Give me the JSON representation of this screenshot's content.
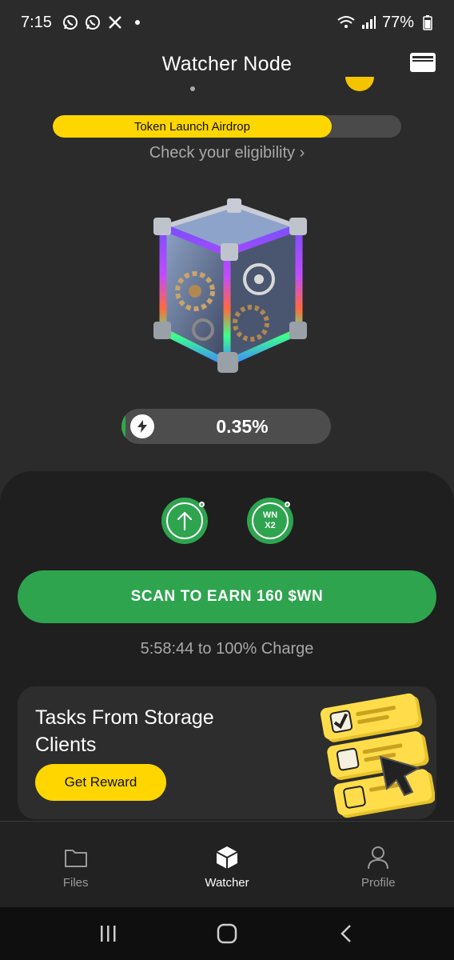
{
  "status_bar": {
    "time": "7:15",
    "battery": "77%",
    "notification_icons": [
      "whatsapp-icon",
      "whatsapp-icon",
      "x-icon"
    ]
  },
  "header": {
    "title": "Watcher Node",
    "wallet_icon": "wallet-icon"
  },
  "airdrop": {
    "label": "Token Launch Airdrop",
    "progress": 0.8,
    "eligibility_link": "Check your eligibility ›"
  },
  "charge": {
    "icon": "bolt-icon",
    "value": "0.35%"
  },
  "actions": {
    "upload_icon": "arrow-up-icon",
    "multiplier_line1": "WN",
    "multiplier_line2": "X2",
    "scan_label": "SCAN TO EARN 160 $WN",
    "charge_time": "5:58:44 to 100% Charge"
  },
  "tasks": {
    "title": "Tasks From Storage Clients",
    "button": "Get Reward"
  },
  "tabs": [
    {
      "label": "Files",
      "icon": "folder-icon",
      "active": false
    },
    {
      "label": "Watcher",
      "icon": "cube-icon",
      "active": true
    },
    {
      "label": "Profile",
      "icon": "person-icon",
      "active": false
    }
  ],
  "colors": {
    "accent_green": "#2ea44f",
    "accent_yellow": "#ffd600",
    "background": "#2b2b2b"
  }
}
